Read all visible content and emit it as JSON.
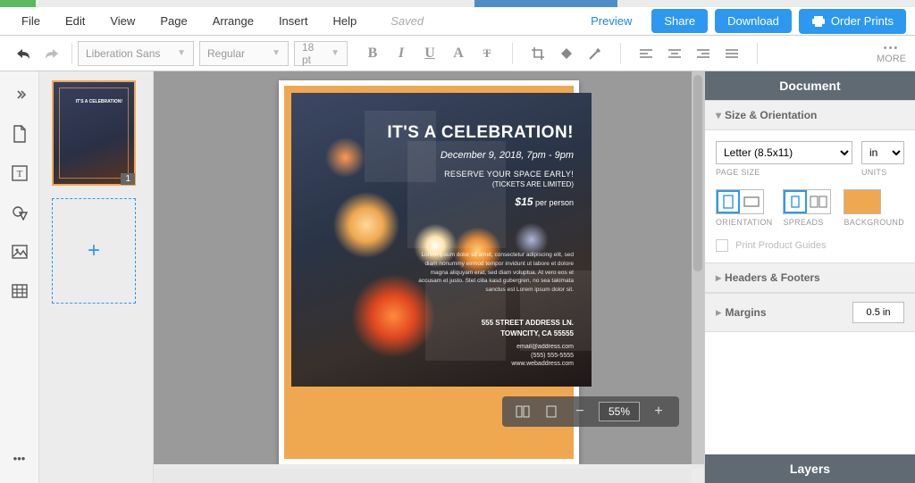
{
  "menu": {
    "items": [
      "File",
      "Edit",
      "View",
      "Page",
      "Arrange",
      "Insert",
      "Help"
    ],
    "saved": "Saved",
    "preview": "Preview",
    "share": "Share",
    "download": "Download",
    "order": "Order Prints"
  },
  "toolbar": {
    "undo": "undo",
    "redo": "redo",
    "font_family": "Liberation Sans",
    "font_weight": "Regular",
    "font_size": "18 pt",
    "more": "MORE"
  },
  "thumbs": {
    "page1_badge": "1"
  },
  "flyer": {
    "title": "IT'S A CELEBRATION!",
    "date": "December 9, 2018, 7pm - 9pm",
    "reserve": "RESERVE YOUR SPACE EARLY!",
    "tickets": "(TICKETS ARE LIMITED)",
    "price_amount": "$15",
    "price_unit": "per person",
    "lorem": "Lorem ipsum dolor sit amet, consectetur adipiscing elit, sed diam nonummy eirmod tempor invidunt ut labore et dolore magna aliquyam erat, sed diam voluptua. At vero eos et accusam et justo. Stet clita kasd gubergren, no sea takimata sanctus est Lorem ipsum dolor sit.",
    "addr1": "555 STREET ADDRESS LN.",
    "addr2": "TOWNCITY, CA 55555",
    "email": "email@address.com",
    "phone": "(555) 555-5555",
    "web": "www.webaddress.com"
  },
  "zoom": {
    "value": "55%"
  },
  "right": {
    "document": "Document",
    "size_orient": "Size & Orientation",
    "page_size_value": "Letter (8.5x11)",
    "page_size_label": "PAGE SIZE",
    "units_value": "in",
    "units_label": "UNITS",
    "orientation_label": "ORIENTATION",
    "spreads_label": "SPREADS",
    "background_label": "BACKGROUND",
    "print_guides": "Print Product Guides",
    "headers_footers": "Headers & Footers",
    "margins_label": "Margins",
    "margins_value": "0.5 in",
    "layers": "Layers"
  }
}
